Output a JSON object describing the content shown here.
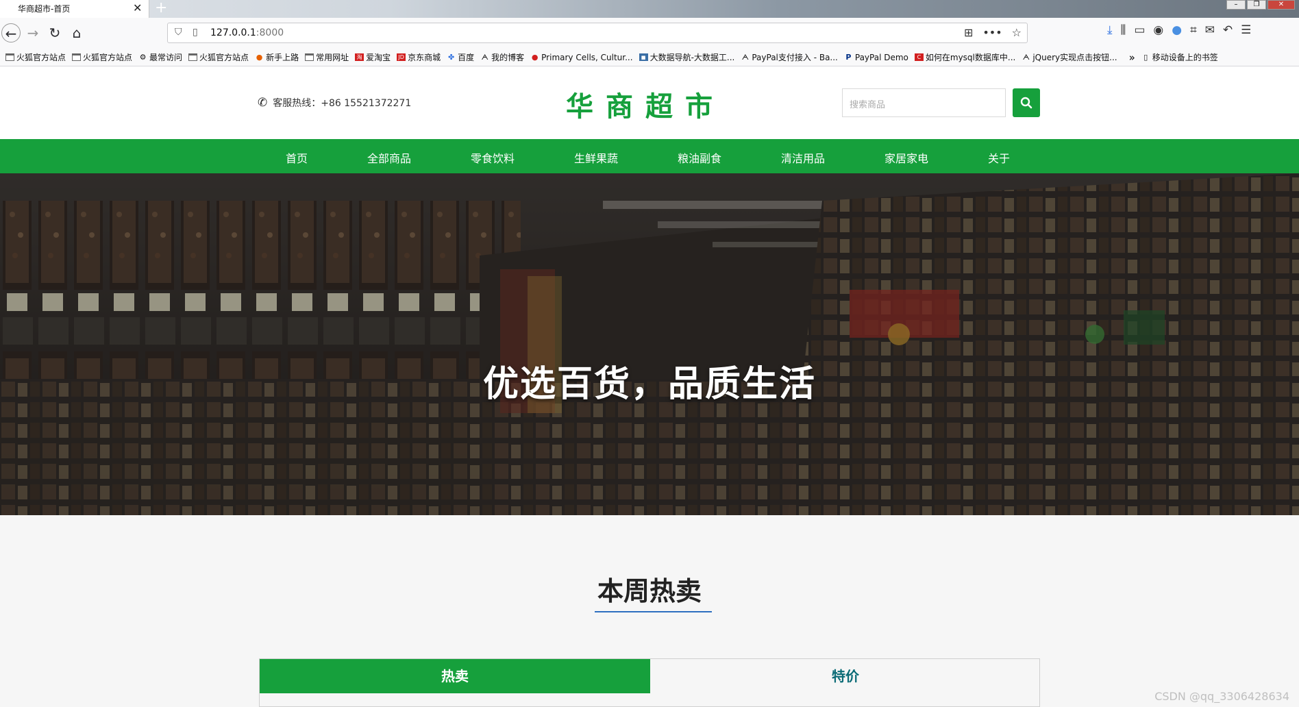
{
  "browser": {
    "tab_title": "华商超市-首页",
    "url_host": "127.0.0.1",
    "url_port": ":8000",
    "bookmarks": [
      {
        "label": "火狐官方站点",
        "icon": "folder"
      },
      {
        "label": "火狐官方站点",
        "icon": "folder"
      },
      {
        "label": "最常访问",
        "icon": "gear"
      },
      {
        "label": "火狐官方站点",
        "icon": "folder"
      },
      {
        "label": "新手上路",
        "icon": "firefox"
      },
      {
        "label": "常用网址",
        "icon": "folder"
      },
      {
        "label": "爱淘宝",
        "icon": "taobao"
      },
      {
        "label": "京东商城",
        "icon": "jd"
      },
      {
        "label": "百度",
        "icon": "baidu"
      },
      {
        "label": "我的博客",
        "icon": "link"
      },
      {
        "label": "Primary Cells, Cultur...",
        "icon": "red-circle"
      },
      {
        "label": "大数据导航-大数据工...",
        "icon": "image"
      },
      {
        "label": "PayPal支付接入 - Ba...",
        "icon": "link"
      },
      {
        "label": "PayPal Demo",
        "icon": "paypal"
      },
      {
        "label": "如何在mysql数据库中...",
        "icon": "csdn"
      },
      {
        "label": "jQuery实现点击按钮...",
        "icon": "link"
      },
      {
        "label": "移动设备上的书签",
        "icon": "mobile"
      }
    ]
  },
  "site": {
    "hotline": "客服热线：+86 15521372271",
    "logo": "华商超市",
    "search_placeholder": "搜索商品",
    "nav": [
      "首页",
      "全部商品",
      "零食饮料",
      "生鲜果蔬",
      "粮油副食",
      "清洁用品",
      "家居家电",
      "关于"
    ],
    "hero_title": "优选百货，品质生活",
    "section_title": "本周热卖",
    "tabs": [
      "热卖",
      "特价"
    ],
    "watermark": "CSDN @qq_3306428634"
  },
  "colors": {
    "brand": "#16a03c",
    "accent": "#2d6fc0",
    "tab_inactive_text": "#0b6b76"
  }
}
